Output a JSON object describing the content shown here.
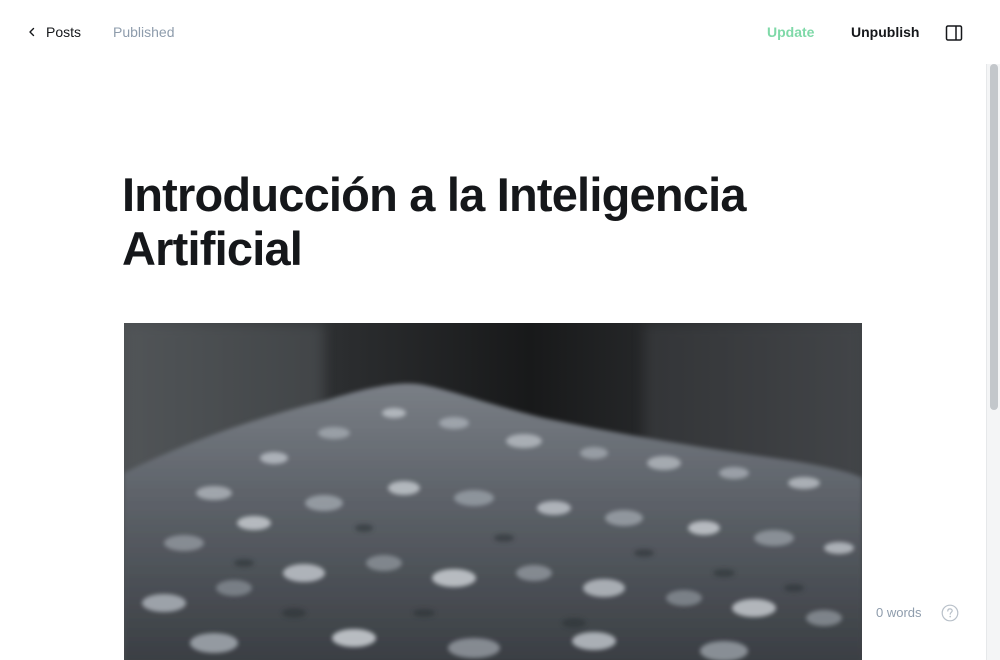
{
  "header": {
    "back_label": "Posts",
    "status": "Published",
    "update_label": "Update",
    "unpublish_label": "Unpublish",
    "icons": {
      "back": "chevron-left-icon",
      "sidebar": "sidebar-toggle-icon"
    }
  },
  "post": {
    "title": "Introducción a la Inteligencia Artificial"
  },
  "footer": {
    "word_count": "0 words",
    "help_icon": "question-mark-icon"
  },
  "colors": {
    "accent": "#7fd9a8",
    "text": "#15171a",
    "muted": "#8e9cac"
  }
}
